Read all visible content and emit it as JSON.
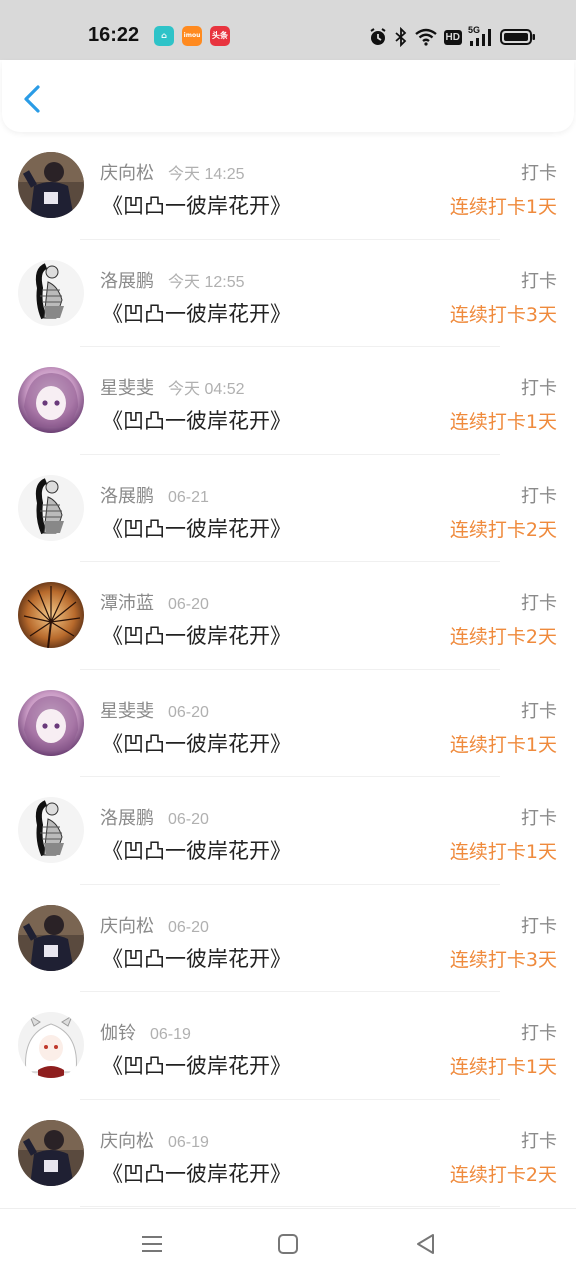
{
  "status_bar": {
    "time": "16:22",
    "apps": [
      {
        "name": "home-app-icon",
        "color": "#2ec3c8",
        "glyph": "⌂"
      },
      {
        "name": "imou-app-icon",
        "color": "#ff8a1f",
        "glyph": "imou"
      },
      {
        "name": "toutiao-app-icon",
        "color": "#e8343f",
        "glyph": "头条"
      }
    ],
    "icons": [
      "alarm-icon",
      "bluetooth-icon",
      "wifi-icon",
      "hd-icon",
      "signal-5g-icon",
      "battery-icon"
    ],
    "hd_label": "HD",
    "network_label": "5G"
  },
  "header": {
    "back_icon": "chevron-left-icon",
    "accent": "#2a9ce6"
  },
  "feed": [
    {
      "user": "庆向松",
      "time": "今天 14:25",
      "title": "《凹凸一彼岸花开》",
      "action": "打卡",
      "streak": "连续打卡1天",
      "avatar": "dark-jacket"
    },
    {
      "user": "洛展鹏",
      "time": "今天 12:55",
      "title": "《凹凸一彼岸花开》",
      "action": "打卡",
      "streak": "连续打卡3天",
      "avatar": "sketch-girl"
    },
    {
      "user": "星斐斐",
      "time": "今天 04:52",
      "title": "《凹凸一彼岸花开》",
      "action": "打卡",
      "streak": "连续打卡1天",
      "avatar": "purple-anime"
    },
    {
      "user": "洛展鹏",
      "time": "06-21",
      "title": "《凹凸一彼岸花开》",
      "action": "打卡",
      "streak": "连续打卡2天",
      "avatar": "sketch-girl"
    },
    {
      "user": "潭沛蓝",
      "time": "06-20",
      "title": "《凹凸一彼岸花开》",
      "action": "打卡",
      "streak": "连续打卡2天",
      "avatar": "dandelion"
    },
    {
      "user": "星斐斐",
      "time": "06-20",
      "title": "《凹凸一彼岸花开》",
      "action": "打卡",
      "streak": "连续打卡1天",
      "avatar": "purple-anime"
    },
    {
      "user": "洛展鹏",
      "time": "06-20",
      "title": "《凹凸一彼岸花开》",
      "action": "打卡",
      "streak": "连续打卡1天",
      "avatar": "sketch-girl"
    },
    {
      "user": "庆向松",
      "time": "06-20",
      "title": "《凹凸一彼岸花开》",
      "action": "打卡",
      "streak": "连续打卡3天",
      "avatar": "dark-jacket"
    },
    {
      "user": "伽铃",
      "time": "06-19",
      "title": "《凹凸一彼岸花开》",
      "action": "打卡",
      "streak": "连续打卡1天",
      "avatar": "white-hair-anime"
    },
    {
      "user": "庆向松",
      "time": "06-19",
      "title": "《凹凸一彼岸花开》",
      "action": "打卡",
      "streak": "连续打卡2天",
      "avatar": "dark-jacket"
    }
  ],
  "colors": {
    "streak": "#ef8a3c",
    "name": "#8a8a8a",
    "title": "#222222"
  },
  "nav_bar": {
    "items": [
      "menu-icon",
      "home-square-icon",
      "back-triangle-icon"
    ]
  }
}
